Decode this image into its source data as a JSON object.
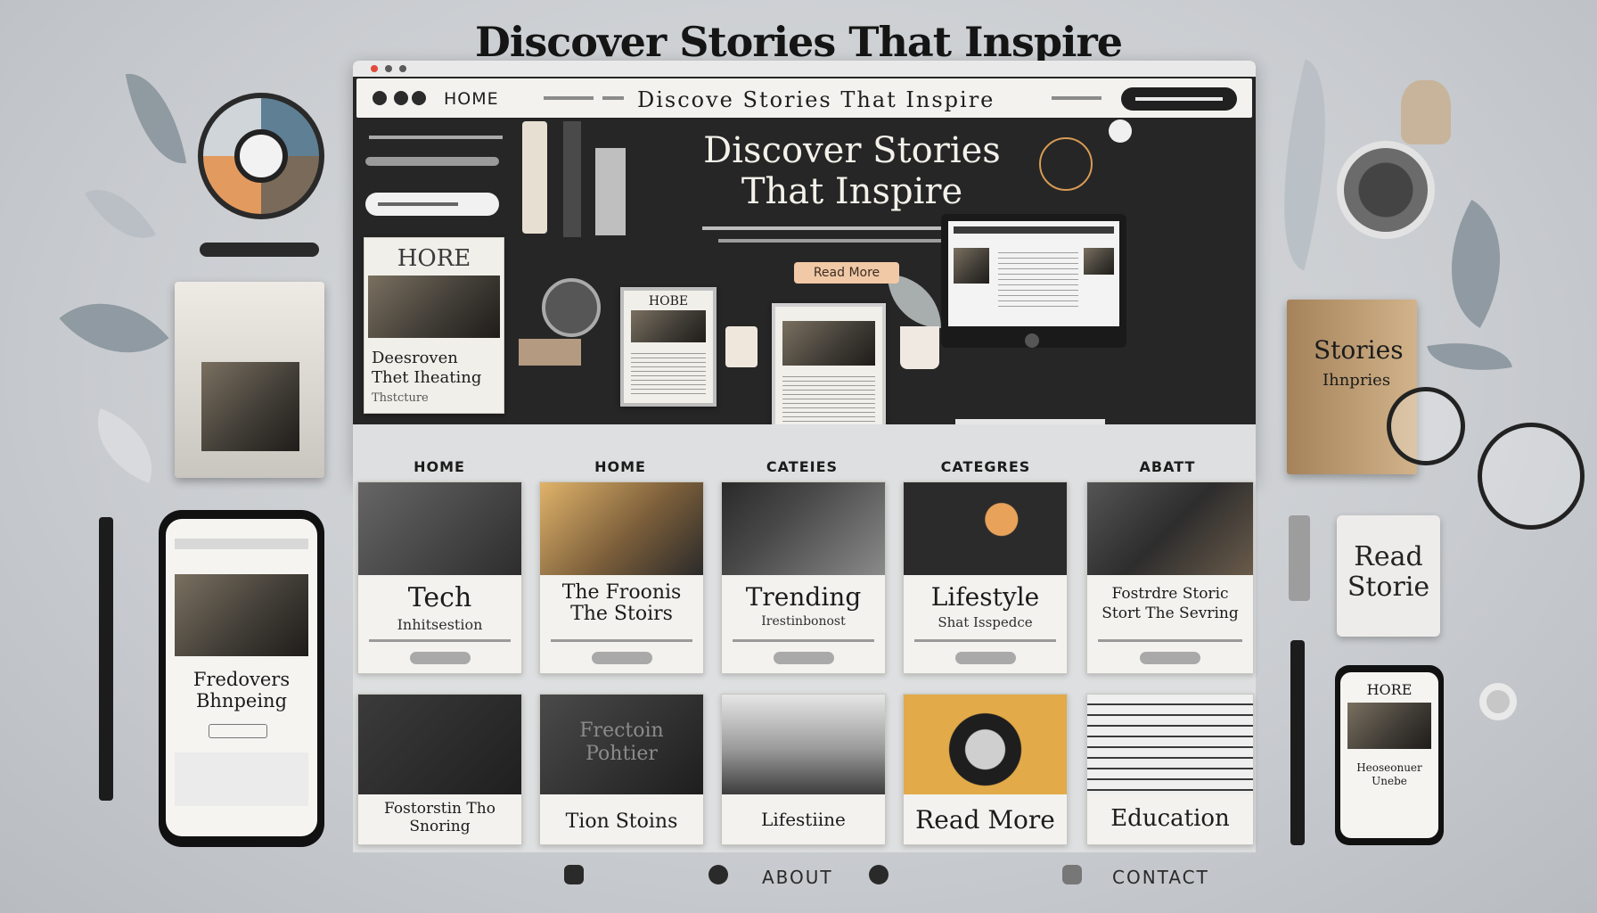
{
  "page": {
    "main_title": "Discover Stories That Inspire"
  },
  "browser": {
    "nav_home": "HOME",
    "nav_center": "Discove Stories That Inspire",
    "hero_title": "Discover Stories That Inspire",
    "hero_button": "Read More",
    "side_card_label": "HORE",
    "side_card_title": "Deesroven Thet Iheating",
    "side_card_sub": "Thstcture",
    "tablet_label": "HOBE"
  },
  "grid": {
    "column_labels": [
      "HOME",
      "HOME",
      "CATEIES",
      "CATEGRES",
      "ABATT"
    ],
    "row1": [
      {
        "title": "Tech",
        "subtitle": "Inhitsestion"
      },
      {
        "title": "The Froonis The Stoirs",
        "subtitle": ""
      },
      {
        "title": "Trending",
        "subtitle": "Irestinbonost"
      },
      {
        "title": "Lifestyle",
        "subtitle": "Shat Isspedce"
      },
      {
        "title": "Fostrdre Storic Stort The Sevring",
        "subtitle": ""
      }
    ],
    "row2": [
      {
        "title": "Fostorstin Tho Snoring",
        "overlay": ""
      },
      {
        "title": "Tion Stoins",
        "overlay": "Frectoin Pohtier"
      },
      {
        "title": "Lifestiine",
        "overlay": ""
      },
      {
        "title": "Read More",
        "overlay": ""
      },
      {
        "title": "Education",
        "overlay": ""
      }
    ]
  },
  "footer": {
    "about": "ABOUT",
    "contact": "CONTACT"
  },
  "props": {
    "left_phone_title": "Fredovers Bhnpeing",
    "right_book_title": "Stories",
    "right_book_sub": "Ihnpries",
    "right_card": "Read Storie",
    "right_phone_label": "HORE",
    "right_phone_title": "Heoseonuer Unebe"
  }
}
